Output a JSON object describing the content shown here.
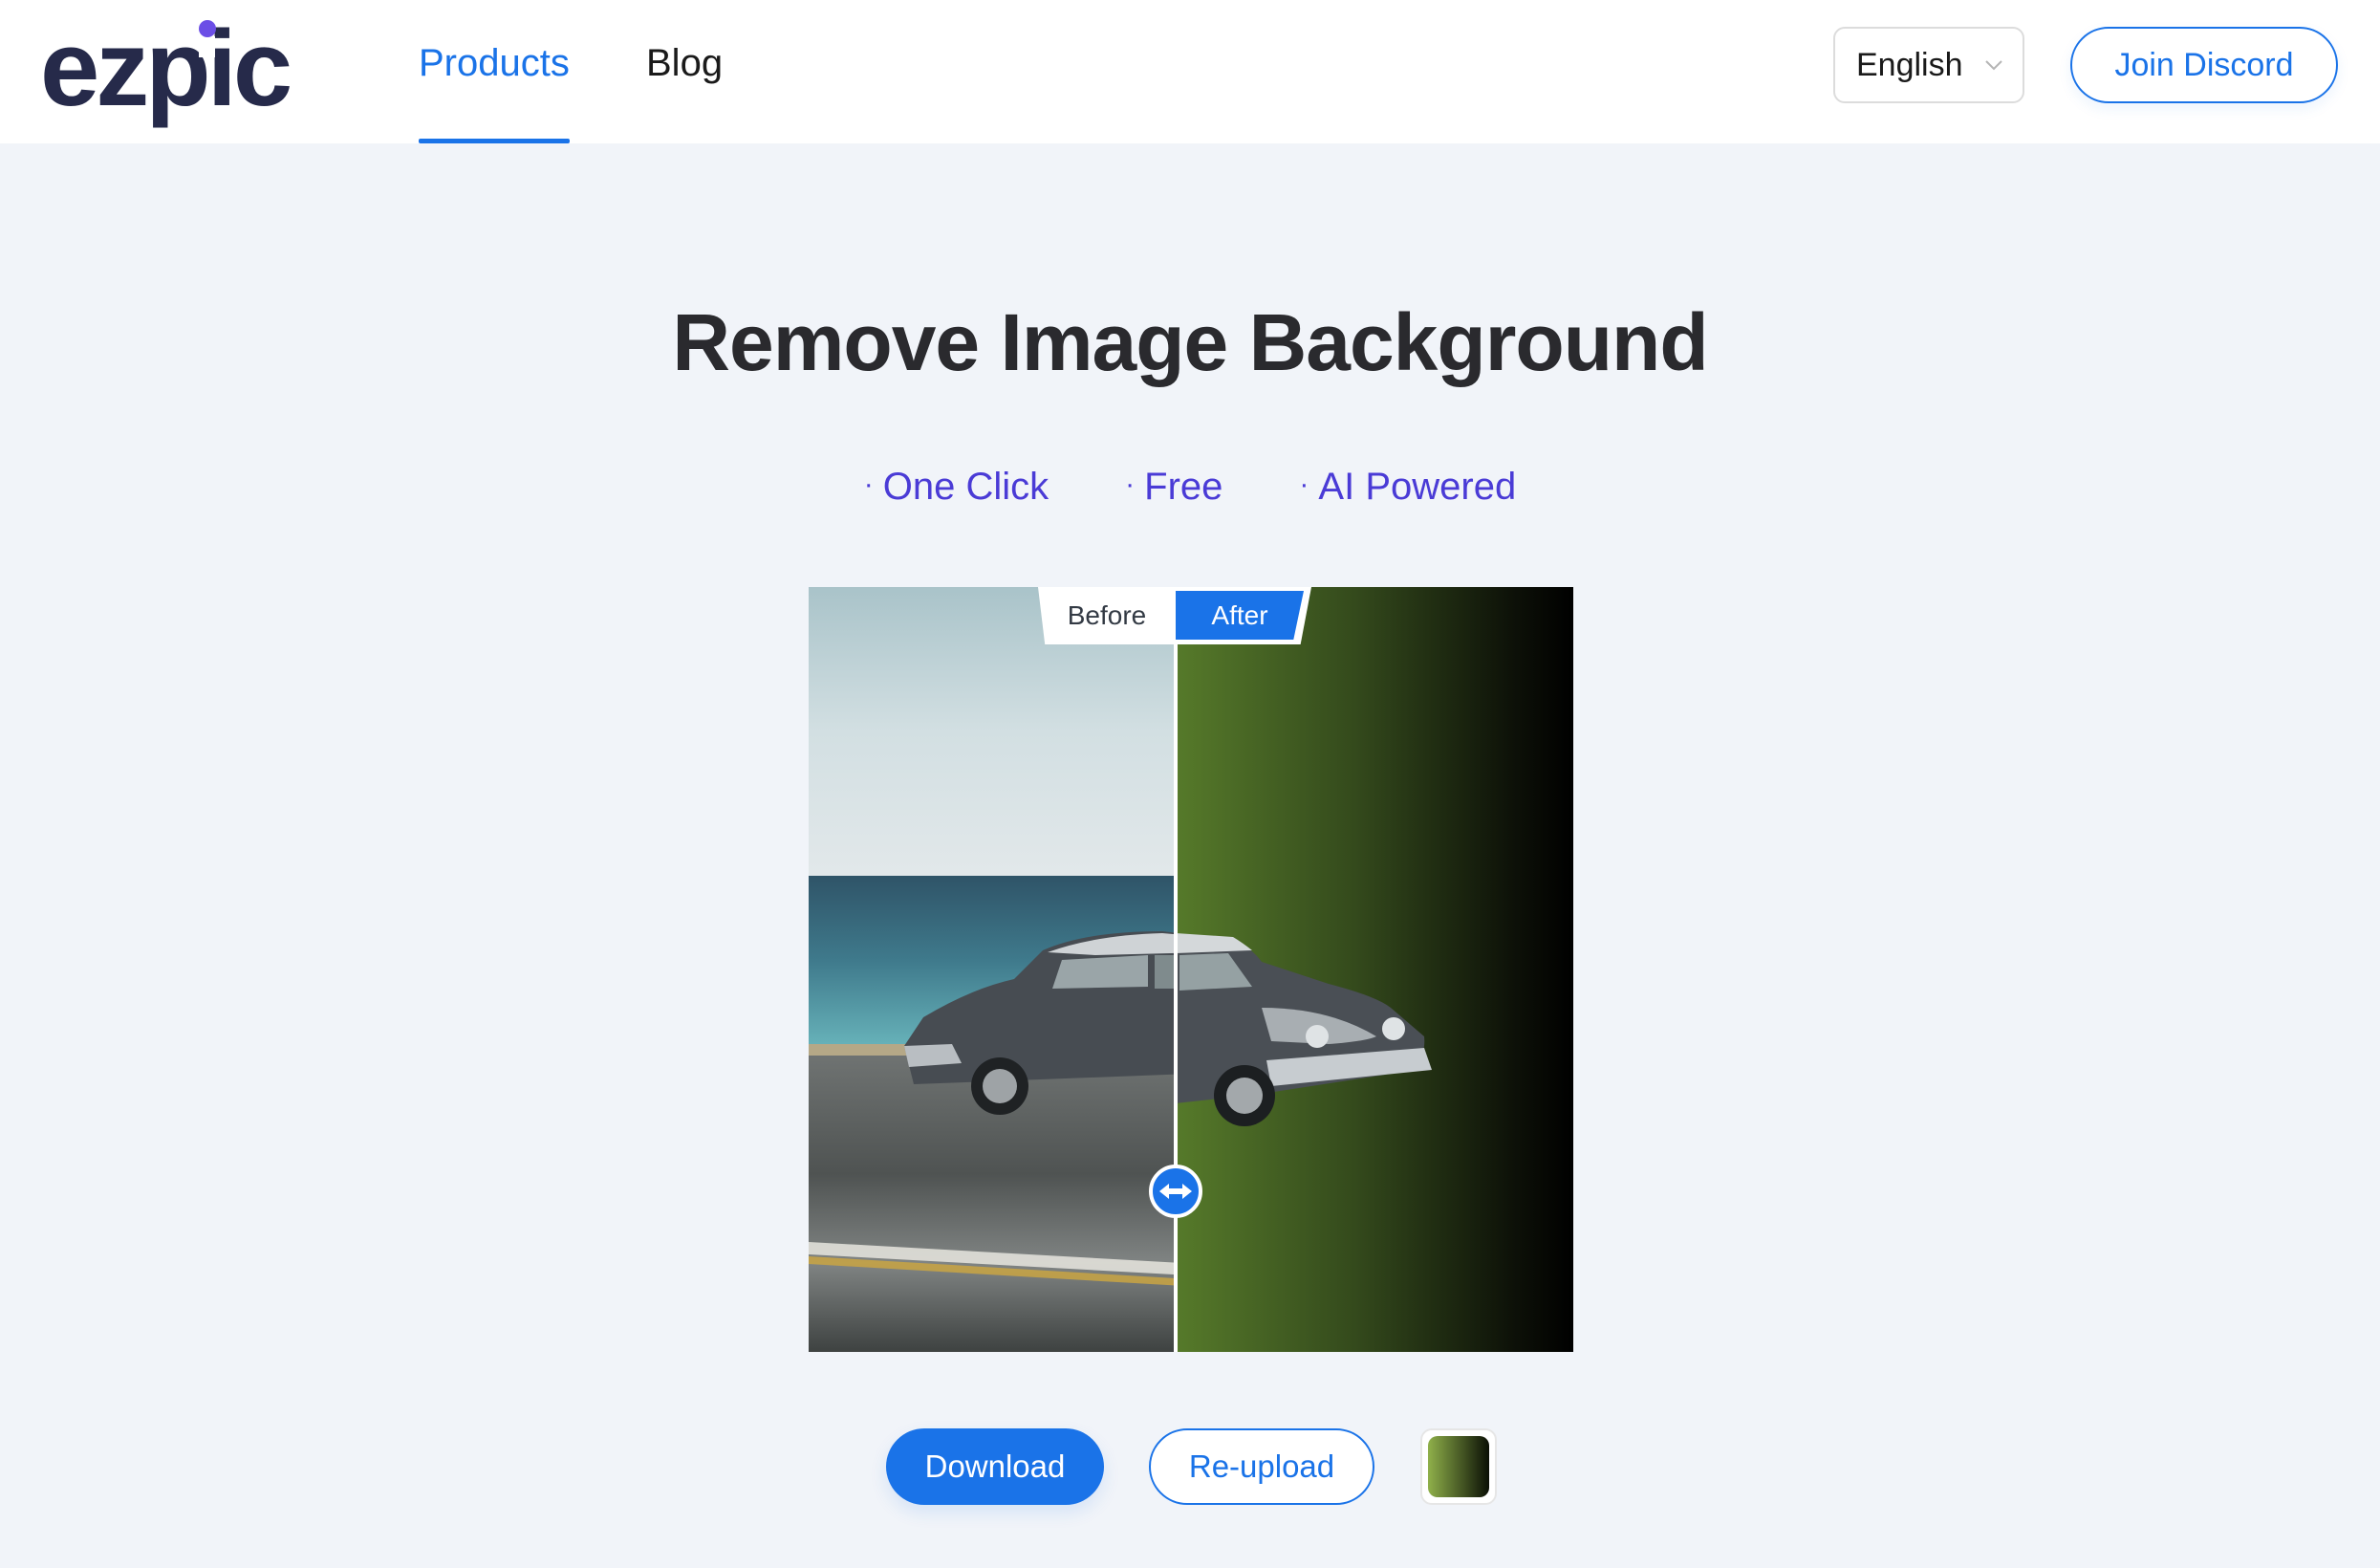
{
  "brand": {
    "name": "ezpic",
    "text_color": "#262a4a",
    "dot_color": "#6b4ee6"
  },
  "nav": {
    "items": [
      {
        "label": "Products",
        "active": true
      },
      {
        "label": "Blog",
        "active": false
      }
    ],
    "accent_color": "#1a73e8"
  },
  "header_right": {
    "language": {
      "selected": "English"
    },
    "discord_label": "Join Discord"
  },
  "hero": {
    "title": "Remove Image Background",
    "features": [
      {
        "bullet": "·",
        "label": "One Click"
      },
      {
        "bullet": "·",
        "label": "Free"
      },
      {
        "bullet": "·",
        "label": "AI Powered"
      }
    ],
    "feature_color": "#4a3bd6"
  },
  "comparison": {
    "before_label": "Before",
    "after_label": "After",
    "slider_position": 0.48,
    "background_gradient": {
      "from": "#567a2a",
      "to": "#000000"
    }
  },
  "actions": {
    "download_label": "Download",
    "reupload_label": "Re-upload",
    "swatch_gradient": {
      "from": "#8fb04a",
      "to": "#0a0f05"
    }
  }
}
